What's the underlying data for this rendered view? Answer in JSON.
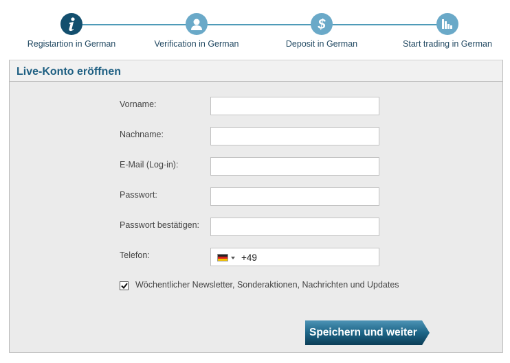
{
  "stepper": {
    "steps": [
      {
        "label": "Registartion in German",
        "icon": "info-icon",
        "state": "active"
      },
      {
        "label": "Verification in German",
        "icon": "user-icon",
        "state": "inactive"
      },
      {
        "label": "Deposit in German",
        "icon": "dollar-icon",
        "state": "inactive"
      },
      {
        "label": "Start trading in German",
        "icon": "bar-chart-icon",
        "state": "inactive"
      }
    ],
    "colors": {
      "active": "#134f6e",
      "inactive": "#6aa9c8",
      "line": "#4f9bb8"
    }
  },
  "form": {
    "title": "Live-Konto eröffnen",
    "fields": [
      {
        "label": "Vorname:",
        "value": "",
        "type": "text"
      },
      {
        "label": "Nachname:",
        "value": "",
        "type": "text"
      },
      {
        "label": "E-Mail (Log-in):",
        "value": "",
        "type": "email"
      },
      {
        "label": "Passwort:",
        "value": "",
        "type": "password"
      },
      {
        "label": "Passwort bestätigen:",
        "value": "",
        "type": "password"
      }
    ],
    "phone": {
      "label": "Telefon:",
      "country": "Germany",
      "flag_icon": "germany-flag-icon",
      "value": "+49"
    },
    "newsletter": {
      "label": "Wöchentlicher Newsletter, Sonderaktionen, Nachrichten und Updates",
      "checked": true
    },
    "submit_label": "Speichern und weiter"
  }
}
